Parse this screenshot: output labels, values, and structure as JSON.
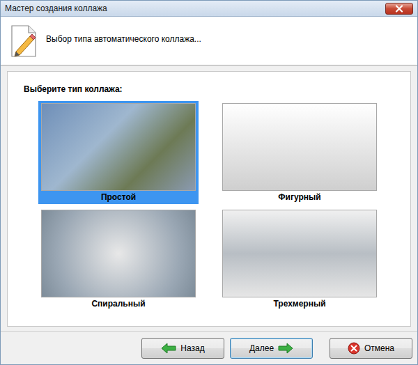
{
  "window": {
    "title": "Мастер создания коллажа"
  },
  "header": {
    "text": "Выбор типа автоматического коллажа..."
  },
  "prompt": "Выберите тип коллажа:",
  "collage_types": [
    {
      "name": "Простой",
      "selected": true
    },
    {
      "name": "Фигурный",
      "selected": false
    },
    {
      "name": "Спиральный",
      "selected": false
    },
    {
      "name": "Трехмерный",
      "selected": false
    }
  ],
  "buttons": [
    {
      "label": "Назад",
      "kind": "back",
      "focused": false
    },
    {
      "label": "Далее",
      "kind": "next",
      "focused": true
    },
    {
      "label": "Отмена",
      "kind": "cancel",
      "focused": false
    }
  ]
}
